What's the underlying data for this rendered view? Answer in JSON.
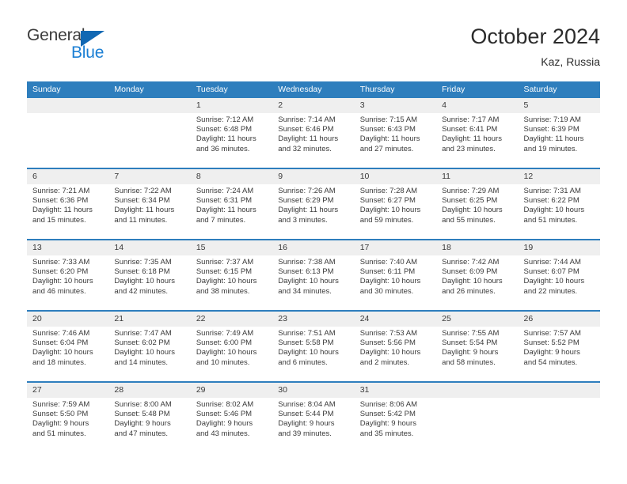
{
  "logo": {
    "word_general": "General",
    "word_blue": "Blue",
    "triangle_color": "#1268b3",
    "blue_text_color": "#1b7fd4"
  },
  "header": {
    "title": "October 2024",
    "subtitle": "Kaz, Russia",
    "accent_color": "#2e7ebd"
  },
  "calendar": {
    "weekdays": [
      "Sunday",
      "Monday",
      "Tuesday",
      "Wednesday",
      "Thursday",
      "Friday",
      "Saturday"
    ],
    "labels": {
      "sunrise": "Sunrise:",
      "sunset": "Sunset:",
      "daylight": "Daylight:"
    },
    "weeks": [
      [
        {
          "day": "",
          "sunrise": "",
          "sunset": "",
          "daylight_line1": "",
          "daylight_line2": ""
        },
        {
          "day": "",
          "sunrise": "",
          "sunset": "",
          "daylight_line1": "",
          "daylight_line2": ""
        },
        {
          "day": "1",
          "sunrise": "Sunrise: 7:12 AM",
          "sunset": "Sunset: 6:48 PM",
          "daylight_line1": "Daylight: 11 hours",
          "daylight_line2": "and 36 minutes."
        },
        {
          "day": "2",
          "sunrise": "Sunrise: 7:14 AM",
          "sunset": "Sunset: 6:46 PM",
          "daylight_line1": "Daylight: 11 hours",
          "daylight_line2": "and 32 minutes."
        },
        {
          "day": "3",
          "sunrise": "Sunrise: 7:15 AM",
          "sunset": "Sunset: 6:43 PM",
          "daylight_line1": "Daylight: 11 hours",
          "daylight_line2": "and 27 minutes."
        },
        {
          "day": "4",
          "sunrise": "Sunrise: 7:17 AM",
          "sunset": "Sunset: 6:41 PM",
          "daylight_line1": "Daylight: 11 hours",
          "daylight_line2": "and 23 minutes."
        },
        {
          "day": "5",
          "sunrise": "Sunrise: 7:19 AM",
          "sunset": "Sunset: 6:39 PM",
          "daylight_line1": "Daylight: 11 hours",
          "daylight_line2": "and 19 minutes."
        }
      ],
      [
        {
          "day": "6",
          "sunrise": "Sunrise: 7:21 AM",
          "sunset": "Sunset: 6:36 PM",
          "daylight_line1": "Daylight: 11 hours",
          "daylight_line2": "and 15 minutes."
        },
        {
          "day": "7",
          "sunrise": "Sunrise: 7:22 AM",
          "sunset": "Sunset: 6:34 PM",
          "daylight_line1": "Daylight: 11 hours",
          "daylight_line2": "and 11 minutes."
        },
        {
          "day": "8",
          "sunrise": "Sunrise: 7:24 AM",
          "sunset": "Sunset: 6:31 PM",
          "daylight_line1": "Daylight: 11 hours",
          "daylight_line2": "and 7 minutes."
        },
        {
          "day": "9",
          "sunrise": "Sunrise: 7:26 AM",
          "sunset": "Sunset: 6:29 PM",
          "daylight_line1": "Daylight: 11 hours",
          "daylight_line2": "and 3 minutes."
        },
        {
          "day": "10",
          "sunrise": "Sunrise: 7:28 AM",
          "sunset": "Sunset: 6:27 PM",
          "daylight_line1": "Daylight: 10 hours",
          "daylight_line2": "and 59 minutes."
        },
        {
          "day": "11",
          "sunrise": "Sunrise: 7:29 AM",
          "sunset": "Sunset: 6:25 PM",
          "daylight_line1": "Daylight: 10 hours",
          "daylight_line2": "and 55 minutes."
        },
        {
          "day": "12",
          "sunrise": "Sunrise: 7:31 AM",
          "sunset": "Sunset: 6:22 PM",
          "daylight_line1": "Daylight: 10 hours",
          "daylight_line2": "and 51 minutes."
        }
      ],
      [
        {
          "day": "13",
          "sunrise": "Sunrise: 7:33 AM",
          "sunset": "Sunset: 6:20 PM",
          "daylight_line1": "Daylight: 10 hours",
          "daylight_line2": "and 46 minutes."
        },
        {
          "day": "14",
          "sunrise": "Sunrise: 7:35 AM",
          "sunset": "Sunset: 6:18 PM",
          "daylight_line1": "Daylight: 10 hours",
          "daylight_line2": "and 42 minutes."
        },
        {
          "day": "15",
          "sunrise": "Sunrise: 7:37 AM",
          "sunset": "Sunset: 6:15 PM",
          "daylight_line1": "Daylight: 10 hours",
          "daylight_line2": "and 38 minutes."
        },
        {
          "day": "16",
          "sunrise": "Sunrise: 7:38 AM",
          "sunset": "Sunset: 6:13 PM",
          "daylight_line1": "Daylight: 10 hours",
          "daylight_line2": "and 34 minutes."
        },
        {
          "day": "17",
          "sunrise": "Sunrise: 7:40 AM",
          "sunset": "Sunset: 6:11 PM",
          "daylight_line1": "Daylight: 10 hours",
          "daylight_line2": "and 30 minutes."
        },
        {
          "day": "18",
          "sunrise": "Sunrise: 7:42 AM",
          "sunset": "Sunset: 6:09 PM",
          "daylight_line1": "Daylight: 10 hours",
          "daylight_line2": "and 26 minutes."
        },
        {
          "day": "19",
          "sunrise": "Sunrise: 7:44 AM",
          "sunset": "Sunset: 6:07 PM",
          "daylight_line1": "Daylight: 10 hours",
          "daylight_line2": "and 22 minutes."
        }
      ],
      [
        {
          "day": "20",
          "sunrise": "Sunrise: 7:46 AM",
          "sunset": "Sunset: 6:04 PM",
          "daylight_line1": "Daylight: 10 hours",
          "daylight_line2": "and 18 minutes."
        },
        {
          "day": "21",
          "sunrise": "Sunrise: 7:47 AM",
          "sunset": "Sunset: 6:02 PM",
          "daylight_line1": "Daylight: 10 hours",
          "daylight_line2": "and 14 minutes."
        },
        {
          "day": "22",
          "sunrise": "Sunrise: 7:49 AM",
          "sunset": "Sunset: 6:00 PM",
          "daylight_line1": "Daylight: 10 hours",
          "daylight_line2": "and 10 minutes."
        },
        {
          "day": "23",
          "sunrise": "Sunrise: 7:51 AM",
          "sunset": "Sunset: 5:58 PM",
          "daylight_line1": "Daylight: 10 hours",
          "daylight_line2": "and 6 minutes."
        },
        {
          "day": "24",
          "sunrise": "Sunrise: 7:53 AM",
          "sunset": "Sunset: 5:56 PM",
          "daylight_line1": "Daylight: 10 hours",
          "daylight_line2": "and 2 minutes."
        },
        {
          "day": "25",
          "sunrise": "Sunrise: 7:55 AM",
          "sunset": "Sunset: 5:54 PM",
          "daylight_line1": "Daylight: 9 hours",
          "daylight_line2": "and 58 minutes."
        },
        {
          "day": "26",
          "sunrise": "Sunrise: 7:57 AM",
          "sunset": "Sunset: 5:52 PM",
          "daylight_line1": "Daylight: 9 hours",
          "daylight_line2": "and 54 minutes."
        }
      ],
      [
        {
          "day": "27",
          "sunrise": "Sunrise: 7:59 AM",
          "sunset": "Sunset: 5:50 PM",
          "daylight_line1": "Daylight: 9 hours",
          "daylight_line2": "and 51 minutes."
        },
        {
          "day": "28",
          "sunrise": "Sunrise: 8:00 AM",
          "sunset": "Sunset: 5:48 PM",
          "daylight_line1": "Daylight: 9 hours",
          "daylight_line2": "and 47 minutes."
        },
        {
          "day": "29",
          "sunrise": "Sunrise: 8:02 AM",
          "sunset": "Sunset: 5:46 PM",
          "daylight_line1": "Daylight: 9 hours",
          "daylight_line2": "and 43 minutes."
        },
        {
          "day": "30",
          "sunrise": "Sunrise: 8:04 AM",
          "sunset": "Sunset: 5:44 PM",
          "daylight_line1": "Daylight: 9 hours",
          "daylight_line2": "and 39 minutes."
        },
        {
          "day": "31",
          "sunrise": "Sunrise: 8:06 AM",
          "sunset": "Sunset: 5:42 PM",
          "daylight_line1": "Daylight: 9 hours",
          "daylight_line2": "and 35 minutes."
        },
        {
          "day": "",
          "sunrise": "",
          "sunset": "",
          "daylight_line1": "",
          "daylight_line2": ""
        },
        {
          "day": "",
          "sunrise": "",
          "sunset": "",
          "daylight_line1": "",
          "daylight_line2": ""
        }
      ]
    ]
  }
}
